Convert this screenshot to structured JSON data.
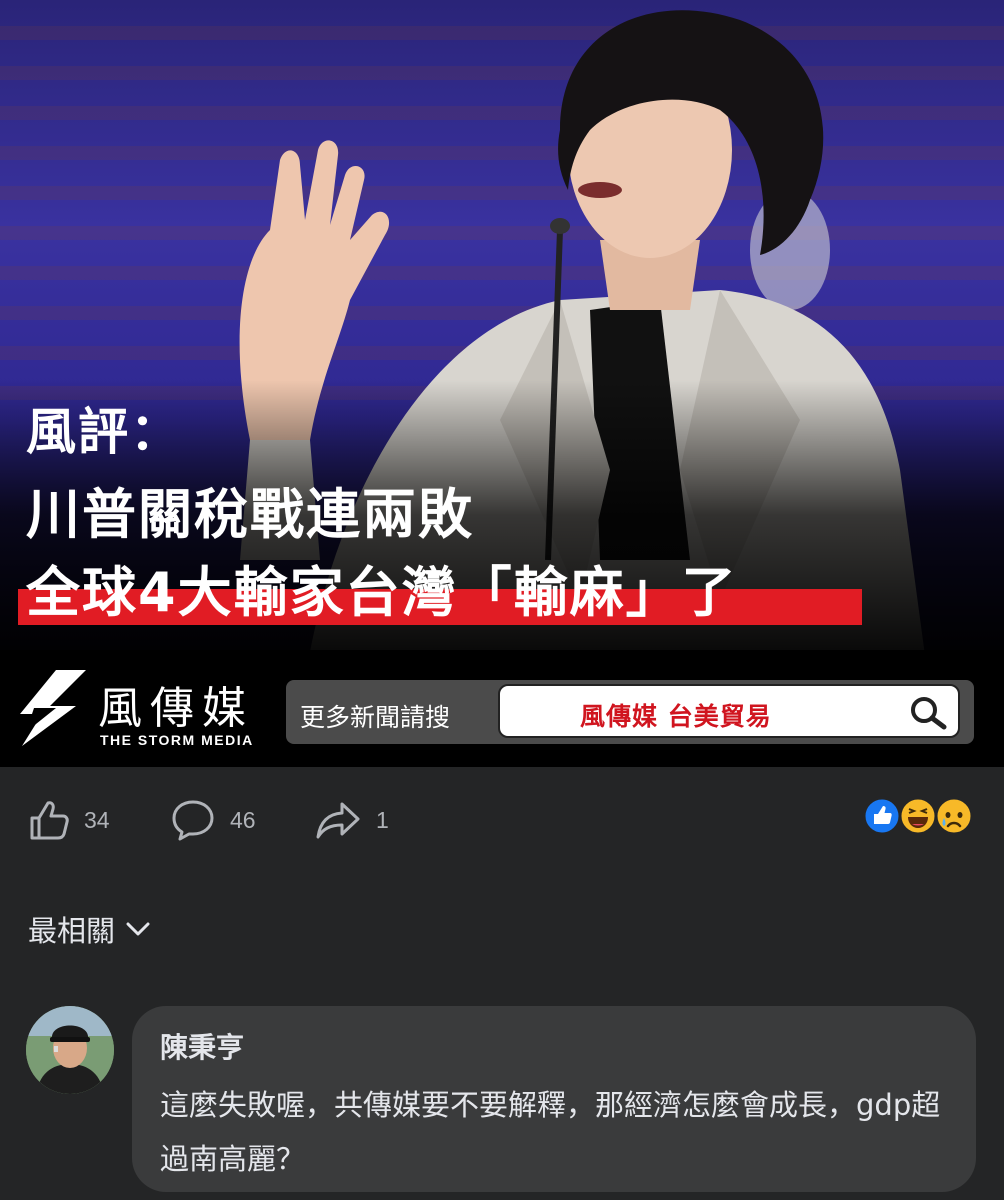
{
  "post": {
    "headline_line1": "風評：",
    "headline_line2": "川普關稅戰連兩敗",
    "headline_line3": "全球4大輸家台灣「輸麻」了",
    "brand_cn": "風傳媒",
    "brand_en": "THE STORM MEDIA",
    "search_prompt": "更多新聞請搜",
    "search_query": "風傳媒 台美貿易"
  },
  "actions": {
    "likes": "34",
    "comments": "46",
    "shares": "1",
    "reaction_icons": [
      "like-reaction-icon",
      "haha-reaction-icon",
      "sad-reaction-icon"
    ]
  },
  "sort": {
    "label": "最相關"
  },
  "comment": {
    "author": "陳秉亨",
    "text": "這麼失敗喔，共傳媒要不要解釋，那經濟怎麼會成長，gdp超過南高麗？"
  },
  "colors": {
    "background": "#242526",
    "bubble": "#3a3b3c",
    "headline_red": "#e11c24",
    "like_blue": "#1877f2"
  }
}
